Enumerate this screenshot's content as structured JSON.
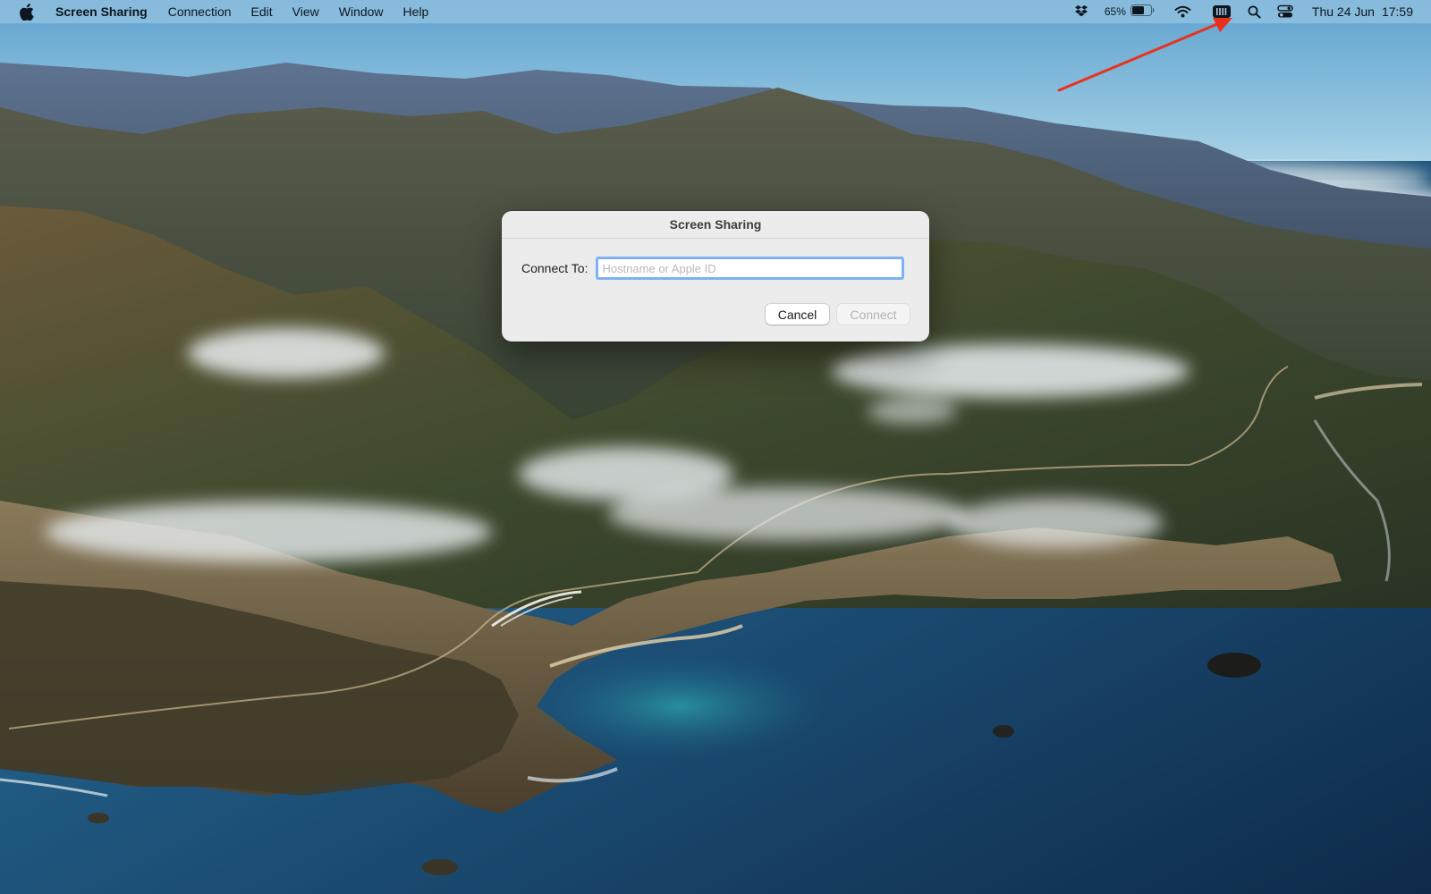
{
  "menubar": {
    "app_name": "Screen Sharing",
    "menus": [
      "Connection",
      "Edit",
      "View",
      "Window",
      "Help"
    ],
    "battery_percent": "65%",
    "battery_level": 0.65,
    "date": "Thu 24 Jun",
    "time": "17:59",
    "icons": [
      "apple-logo-icon",
      "dropbox-icon",
      "battery-icon",
      "wifi-icon",
      "menu-extra-icon",
      "spotlight-search-icon",
      "control-center-icon"
    ]
  },
  "dialog": {
    "title": "Screen Sharing",
    "connect_label": "Connect To:",
    "host_placeholder": "Hostname or Apple ID",
    "host_value": "",
    "cancel_label": "Cancel",
    "connect_label_button": "Connect"
  },
  "annotation": {
    "color": "#e8321f",
    "points_to": "spotlight-search-icon"
  },
  "colors": {
    "focus_ring": "#7fb0f4",
    "dialog_bg": "#ececec",
    "disabled_text": "#b3b3b3"
  }
}
